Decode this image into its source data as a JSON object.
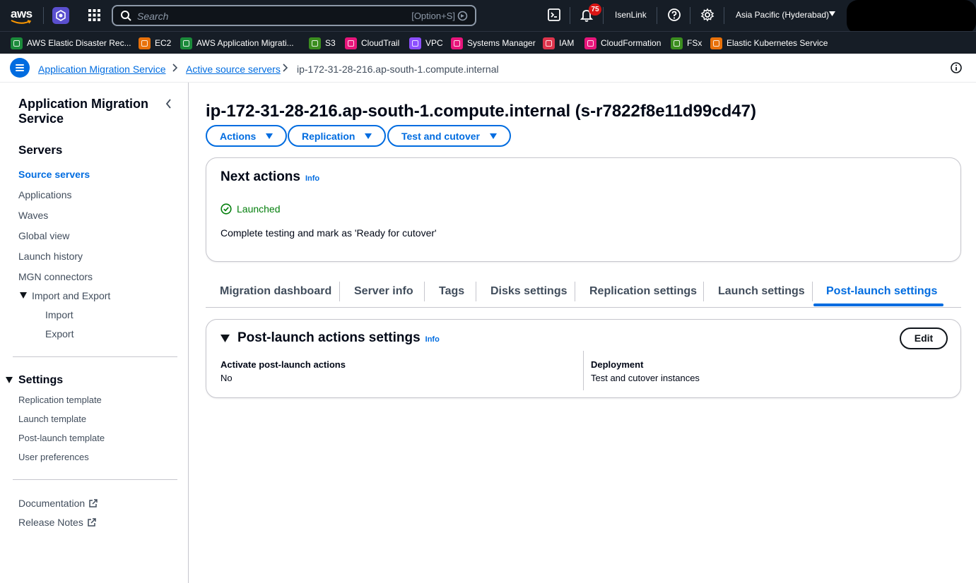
{
  "topnav": {
    "search_placeholder": "Search",
    "search_shortcut": "[Option+S]",
    "notification_count": "75",
    "user": "IsenLink",
    "region": "Asia Pacific (Hyderabad)"
  },
  "favorites": [
    {
      "label": "AWS Elastic Disaster Rec...",
      "color": "#1b8a3a"
    },
    {
      "label": "EC2",
      "color": "#e8710a"
    },
    {
      "label": "AWS Application Migrati...",
      "color": "#1b8a3a"
    },
    {
      "label": "S3",
      "color": "#3b8d1f"
    },
    {
      "label": "CloudTrail",
      "color": "#e7157b"
    },
    {
      "label": "VPC",
      "color": "#8c4fff"
    },
    {
      "label": "Systems Manager",
      "color": "#e7157b"
    },
    {
      "label": "IAM",
      "color": "#dd344c"
    },
    {
      "label": "CloudFormation",
      "color": "#e7157b"
    },
    {
      "label": "FSx",
      "color": "#3b8d1f"
    },
    {
      "label": "Elastic Kubernetes Service",
      "color": "#e8710a"
    }
  ],
  "breadcrumb": {
    "items": [
      "Application Migration Service",
      "Active source servers",
      "ip-172-31-28-216.ap-south-1.compute.internal"
    ]
  },
  "sidebar": {
    "title": "Application Migration Service",
    "servers_heading": "Servers",
    "servers_items": [
      "Source servers",
      "Applications",
      "Waves",
      "Global view",
      "Launch history",
      "MGN connectors"
    ],
    "import_export": "Import and Export",
    "import_export_items": [
      "Import",
      "Export"
    ],
    "settings_heading": "Settings",
    "settings_items": [
      "Replication template",
      "Launch template",
      "Post-launch template",
      "User preferences"
    ],
    "links": [
      "Documentation",
      "Release Notes"
    ]
  },
  "main": {
    "title": "ip-172-31-28-216.ap-south-1.compute.internal (s-r7822f8e11d99cd47)",
    "buttons": [
      "Actions",
      "Replication",
      "Test and cutover"
    ],
    "next_actions": {
      "heading": "Next actions",
      "info": "Info",
      "status": "Launched",
      "description": "Complete testing and mark as 'Ready for cutover'"
    },
    "tabs": [
      "Migration dashboard",
      "Server info",
      "Tags",
      "Disks settings",
      "Replication settings",
      "Launch settings",
      "Post-launch settings"
    ],
    "active_tab": "Post-launch settings",
    "post_launch": {
      "heading": "Post-launch actions settings",
      "info": "Info",
      "edit": "Edit",
      "activate_label": "Activate post-launch actions",
      "activate_value": "No",
      "deployment_label": "Deployment",
      "deployment_value": "Test and cutover instances"
    }
  }
}
